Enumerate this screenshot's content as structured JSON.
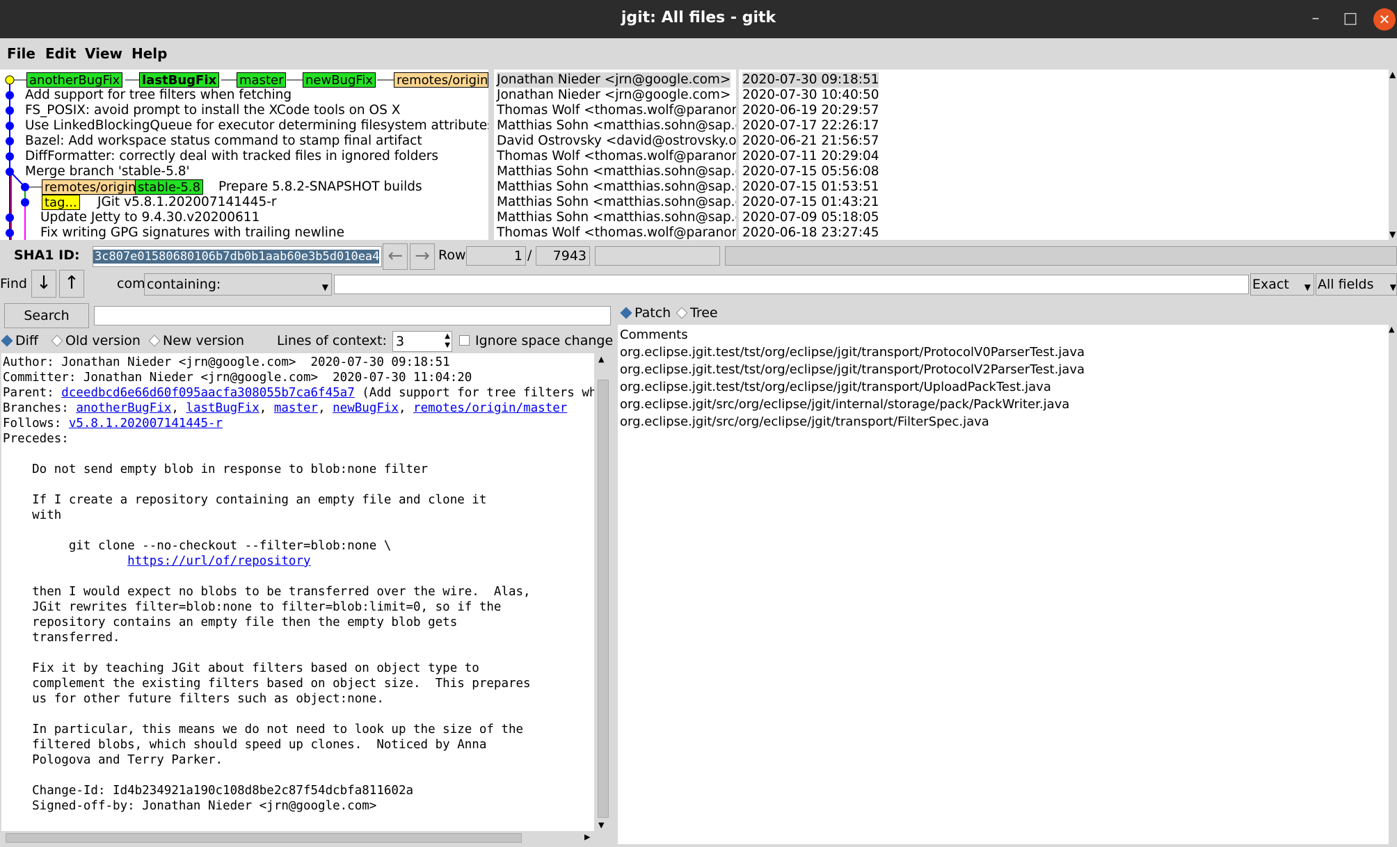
{
  "window": {
    "title": "jgit: All files - gitk"
  },
  "menu": [
    "File",
    "Edit",
    "View",
    "Help"
  ],
  "commits": [
    {
      "subject": "",
      "refs": [
        "anotherBugFix",
        "lastBugFix",
        "master",
        "newBugFix",
        "remotes/origin/"
      ],
      "author": "Jonathan Nieder <jrn@google.com>",
      "date": "2020-07-30 09:18:51"
    },
    {
      "subject": "Add support for tree filters when fetching",
      "author": "Jonathan Nieder <jrn@google.com>",
      "date": "2020-07-30 10:40:50"
    },
    {
      "subject": "FS_POSIX: avoid prompt to install the XCode tools on OS X",
      "author": "Thomas Wolf <thomas.wolf@paranor.c",
      "date": "2020-06-19 20:29:57"
    },
    {
      "subject": "Use LinkedBlockingQueue for executor determining filesystem attributes",
      "author": "Matthias Sohn <matthias.sohn@sap.c",
      "date": "2020-07-17 22:26:17"
    },
    {
      "subject": "Bazel: Add workspace status command to stamp final artifact",
      "author": "David Ostrovsky <david@ostrovsky.or",
      "date": "2020-06-21 21:56:57"
    },
    {
      "subject": "DiffFormatter: correctly deal with tracked files in ignored folders",
      "author": "Thomas Wolf <thomas.wolf@paranor.c",
      "date": "2020-07-11 20:29:04"
    },
    {
      "subject": "Merge branch 'stable-5.8'",
      "author": "Matthias Sohn <matthias.sohn@sap.c",
      "date": "2020-07-15 05:56:08"
    },
    {
      "subject": "Prepare 5.8.2-SNAPSHOT builds",
      "refs": [
        "remotes/origin/",
        "stable-5.8"
      ],
      "author": "Matthias Sohn <matthias.sohn@sap.c",
      "date": "2020-07-15 01:53:51"
    },
    {
      "subject": "JGit v5.8.1.202007141445-r",
      "refs": [
        "tag..."
      ],
      "author": "Matthias Sohn <matthias.sohn@sap.c",
      "date": "2020-07-15 01:43:21"
    },
    {
      "subject": "Update Jetty to 9.4.30.v20200611",
      "author": "Matthias Sohn <matthias.sohn@sap.c",
      "date": "2020-07-09 05:18:05"
    },
    {
      "subject": "Fix writing GPG signatures with trailing newline",
      "author": "Thomas Wolf <thomas.wolf@paranor.c",
      "date": "2020-06-18 23:27:45"
    }
  ],
  "sha": {
    "label": "SHA1 ID:",
    "value": "3c807e01580680106b7db0b1aab60e3b5d010ea4"
  },
  "row": {
    "label": "Row",
    "current": "1",
    "sep": "/",
    "total": "7943"
  },
  "find": {
    "label": "Find",
    "type": "commit",
    "mode": "containing:",
    "match": "Exact",
    "fields": "All fields"
  },
  "search": {
    "button": "Search"
  },
  "diffopts": {
    "diff": "Diff",
    "old": "Old version",
    "new": "New version",
    "context_label": "Lines of context:",
    "context_value": "3",
    "ignore_space": "Ignore space change"
  },
  "viewopts": {
    "patch": "Patch",
    "tree": "Tree"
  },
  "details": {
    "author": "Author: Jonathan Nieder <jrn@google.com>  2020-07-30 09:18:51",
    "committer": "Committer: Jonathan Nieder <jrn@google.com>  2020-07-30 11:04:20",
    "parent_label": "Parent: ",
    "parent_hash": "dceedbcd6e66d60f095aacfa308055b7ca6f45a7",
    "parent_desc": " (Add support for tree filters wher",
    "branches_label": "Branches: ",
    "branches": [
      "anotherBugFix",
      "lastBugFix",
      "master",
      "newBugFix",
      "remotes/origin/master"
    ],
    "follows_label": "Follows: ",
    "follows": "v5.8.1.202007141445-r",
    "precedes": "Precedes:",
    "message": [
      "",
      "    Do not send empty blob in response to blob:none filter",
      "",
      "    If I create a repository containing an empty file and clone it",
      "    with",
      "",
      "         git clone --no-checkout --filter=blob:none \\",
      "                 ",
      "",
      "    then I would expect no blobs to be transferred over the wire.  Alas,",
      "    JGit rewrites filter=blob:none to filter=blob:limit=0, so if the",
      "    repository contains an empty file then the empty blob gets",
      "    transferred.",
      "",
      "    Fix it by teaching JGit about filters based on object type to",
      "    complement the existing filters based on object size.  This prepares",
      "    us for other future filters such as object:none.",
      "",
      "    In particular, this means we do not need to look up the size of the",
      "    filtered blobs, which should speed up clones.  Noticed by Anna",
      "    Pologova and Terry Parker.",
      "",
      "    Change-Id: Id4b234921a190c108d8be2c87f54dcbfa811602a",
      "    Signed-off-by: Jonathan Nieder <jrn@google.com>"
    ],
    "url": "https://url/of/repository"
  },
  "files": [
    "Comments",
    "org.eclipse.jgit.test/tst/org/eclipse/jgit/transport/ProtocolV0ParserTest.java",
    "org.eclipse.jgit.test/tst/org/eclipse/jgit/transport/ProtocolV2ParserTest.java",
    "org.eclipse.jgit.test/tst/org/eclipse/jgit/transport/UploadPackTest.java",
    "org.eclipse.jgit/src/org/eclipse/jgit/internal/storage/pack/PackWriter.java",
    "org.eclipse.jgit/src/org/eclipse/jgit/transport/FilterSpec.java"
  ]
}
